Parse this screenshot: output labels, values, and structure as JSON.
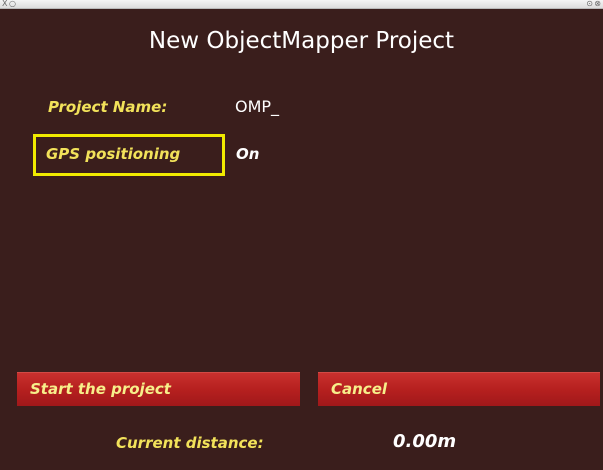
{
  "titlebar": {
    "close_glyph": "X",
    "left_circle_glyph": "○",
    "right_glyph_1": "⊙",
    "right_glyph_2": "⊗"
  },
  "page": {
    "title": "New ObjectMapper Project"
  },
  "form": {
    "project_name_label": "Project Name:",
    "project_name_value": "OMP_",
    "gps_label": "GPS positioning",
    "gps_value": "On"
  },
  "buttons": {
    "start_label": "Start the project",
    "cancel_label": "Cancel"
  },
  "status": {
    "distance_label": "Current distance:",
    "distance_value": "0.00m"
  },
  "colors": {
    "background": "#3a1e1c",
    "label_yellow": "#f2e25a",
    "focus_yellow": "#f0ea00",
    "button_red": "#b6201f",
    "text_white": "#ffffff"
  }
}
